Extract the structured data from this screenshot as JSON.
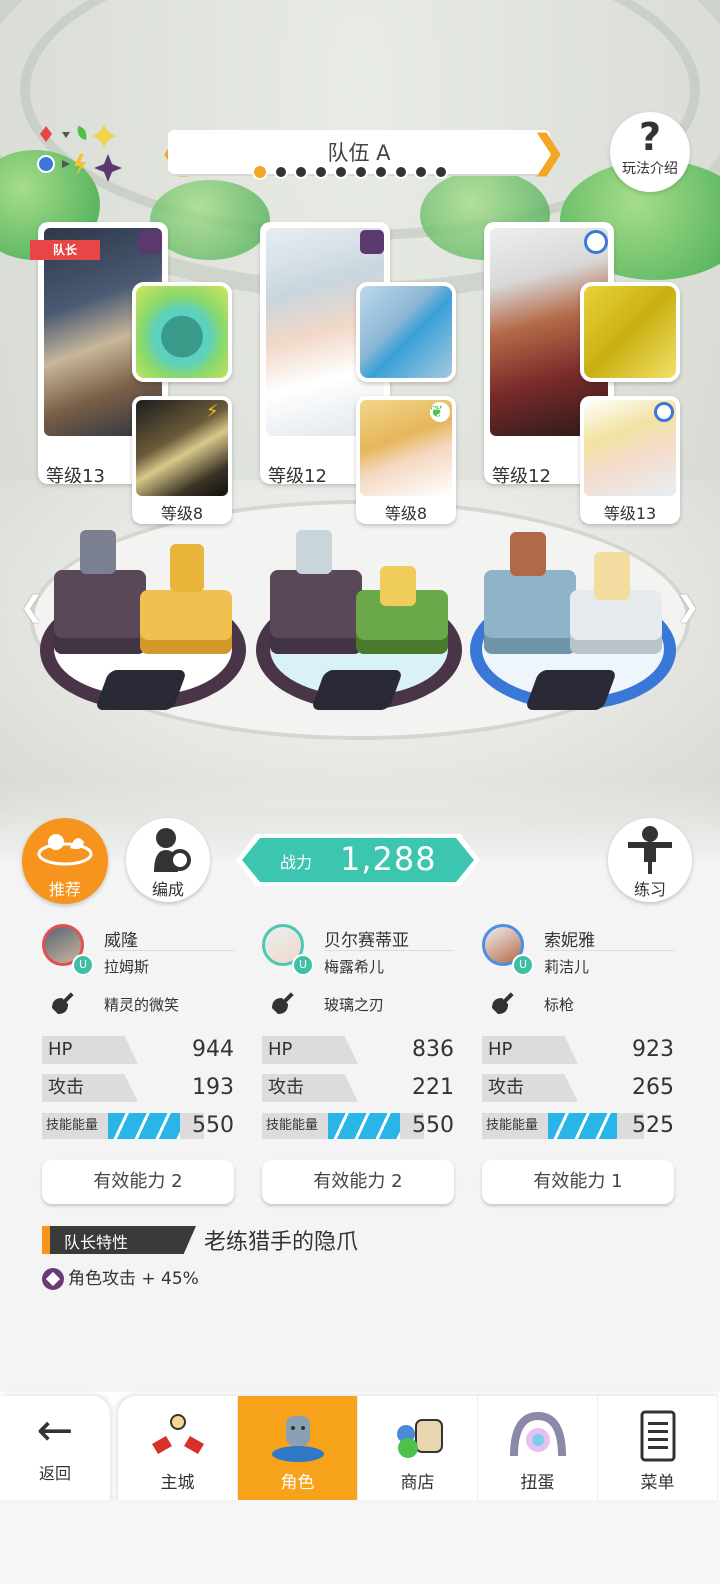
{
  "team": {
    "name": "队伍 A",
    "page_count": 10,
    "active_page": 1
  },
  "help": {
    "label": "玩法介绍"
  },
  "characters": [
    {
      "level": "等级13",
      "leader_tag": "队长",
      "element_color": "#5a3a6e",
      "sub_level": "等级8",
      "sub_icon": "lightning-icon",
      "weapon": "bubble-orb"
    },
    {
      "level": "等级12",
      "leader_tag": "",
      "element_color": "#5a3a6e",
      "sub_level": "等级8",
      "sub_icon": "leaf-icon",
      "weapon": "glass-blade"
    },
    {
      "level": "等级12",
      "leader_tag": "",
      "element_color": "#3a78d8",
      "sub_level": "等级13",
      "sub_icon": "water-icon",
      "weapon": "javelin"
    }
  ],
  "buttons": {
    "recommend": "推荐",
    "formation": "编成",
    "practice": "练习"
  },
  "power": {
    "label": "战力",
    "value": "1,288"
  },
  "stats": [
    {
      "name": "威隆",
      "sub_name": "拉姆斯",
      "weapon": "精灵的微笑",
      "hp_label": "HP",
      "hp": "944",
      "atk_label": "攻击",
      "atk": "193",
      "energy_label": "技能能量",
      "energy": "550",
      "energy_fill": 0.75,
      "ability": "有效能力 2"
    },
    {
      "name": "贝尔赛蒂亚",
      "sub_name": "梅露希儿",
      "weapon": "玻璃之刃",
      "hp_label": "HP",
      "hp": "836",
      "atk_label": "攻击",
      "atk": "221",
      "energy_label": "技能能量",
      "energy": "550",
      "energy_fill": 0.75,
      "ability": "有效能力 2"
    },
    {
      "name": "索妮雅",
      "sub_name": "莉洁儿",
      "weapon": "标枪",
      "hp_label": "HP",
      "hp": "923",
      "atk_label": "攻击",
      "atk": "265",
      "energy_label": "技能能量",
      "energy": "525",
      "energy_fill": 0.72,
      "ability": "有效能力 1"
    }
  ],
  "leader_skill": {
    "tag": "队长特性",
    "name": "老练猎手的隐爪",
    "effect": "角色攻击 + 45%"
  },
  "nav": {
    "back": "返回",
    "tabs": [
      {
        "label": "主城",
        "icon": "castle-icon"
      },
      {
        "label": "角色",
        "icon": "character-icon",
        "active": true
      },
      {
        "label": "商店",
        "icon": "shop-icon"
      },
      {
        "label": "扭蛋",
        "icon": "gacha-icon"
      },
      {
        "label": "菜单",
        "icon": "menu-icon"
      }
    ]
  },
  "colors": {
    "accent": "#f7941d",
    "power_teal": "#3cc6b0",
    "energy_blue": "#29b5e8"
  }
}
